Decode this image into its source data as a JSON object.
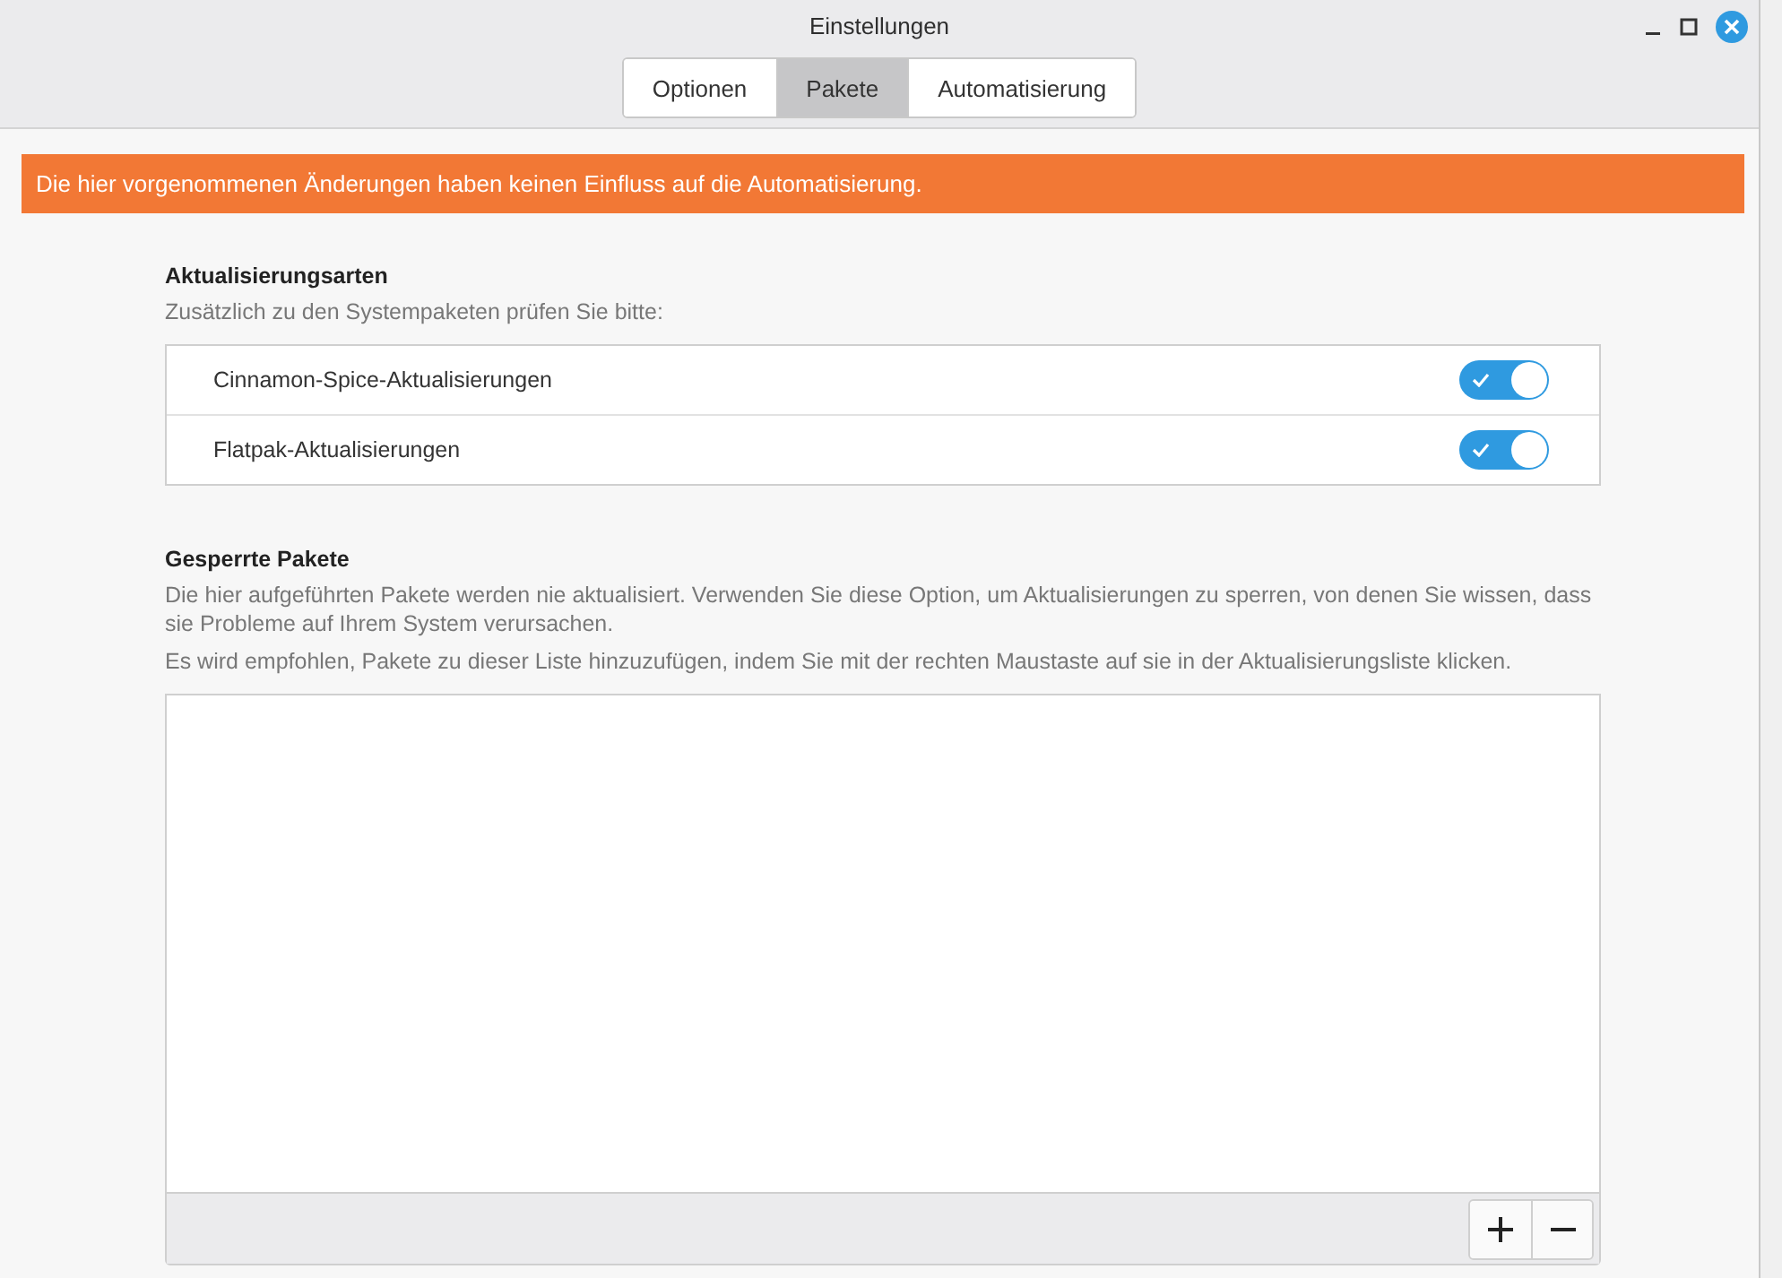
{
  "window": {
    "title": "Einstellungen"
  },
  "tabs": [
    {
      "label": "Optionen",
      "selected": false
    },
    {
      "label": "Pakete",
      "selected": true
    },
    {
      "label": "Automatisierung",
      "selected": false
    }
  ],
  "banner": "Die hier vorgenommenen Änderungen haben keinen Einfluss auf die Automatisierung.",
  "update_types": {
    "heading": "Aktualisierungsarten",
    "subtitle": "Zusätzlich zu den Systempaketen prüfen Sie bitte:",
    "items": [
      {
        "label": "Cinnamon-Spice-Aktualisierungen",
        "on": true
      },
      {
        "label": "Flatpak-Aktualisierungen",
        "on": true
      }
    ]
  },
  "blocked": {
    "heading": "Gesperrte Pakete",
    "paragraphs": [
      "Die hier aufgeführten Pakete werden nie aktualisiert. Verwenden Sie diese Option, um Aktualisierungen zu sperren, von denen Sie wissen, dass sie Probleme auf Ihrem System verursachen.",
      "Es wird empfohlen, Pakete zu dieser Liste hinzuzufügen, indem Sie mit der rechten Maustaste auf sie in der Aktualisierungsliste klicken."
    ]
  }
}
